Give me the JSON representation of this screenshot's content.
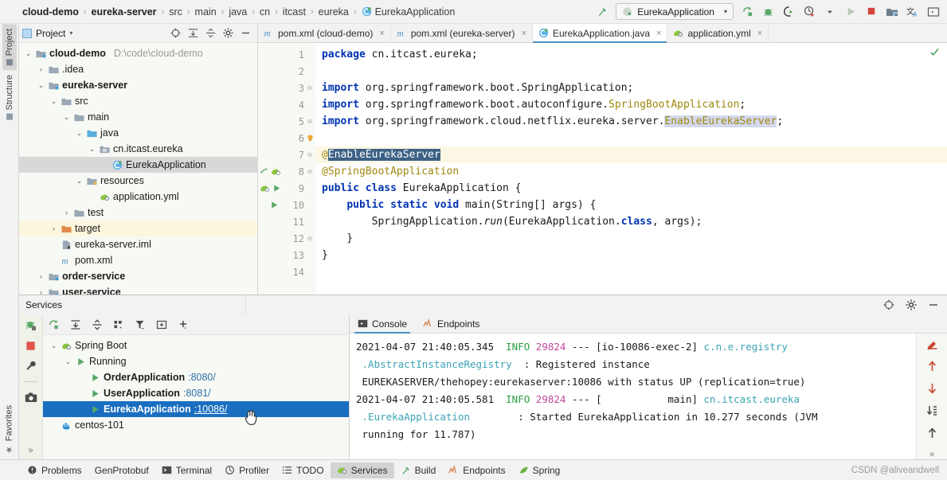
{
  "breadcrumb": {
    "items": [
      {
        "label": "cloud-demo",
        "bold": true
      },
      {
        "label": "eureka-server",
        "bold": true
      },
      {
        "label": "src",
        "bold": false
      },
      {
        "label": "main",
        "bold": false
      },
      {
        "label": "java",
        "bold": false
      },
      {
        "label": "cn",
        "bold": false
      },
      {
        "label": "itcast",
        "bold": false
      },
      {
        "label": "eureka",
        "bold": false
      },
      {
        "label": "EurekaApplication",
        "bold": false,
        "icon": "java-class-icon"
      }
    ],
    "separator": "›"
  },
  "toolbar": {
    "hammer_icon": "build-hammer-icon",
    "run_config_name": "EurekaApplication",
    "run_config_icon": "spring-boot-icon",
    "caret": "▾",
    "icons": [
      "rerun-icon",
      "debug-icon",
      "run-with-coverage-icon",
      "profiler-icon",
      "run-icon",
      "stop-icon",
      "project-structure-icon",
      "translate-icon",
      "terminal-icon"
    ]
  },
  "left_strip": {
    "tabs": [
      {
        "label": "Project",
        "active": true,
        "icon": "project-icon"
      },
      {
        "label": "Structure",
        "active": false,
        "icon": "structure-icon"
      }
    ],
    "bottom_tabs": [
      {
        "label": "Favorites",
        "active": false,
        "icon": "star-icon"
      }
    ]
  },
  "project_panel": {
    "title": "Project",
    "title_caret": "▾",
    "header_icons": [
      "locate-icon",
      "expand-all-icon",
      "collapse-all-icon",
      "settings-gear-icon",
      "hide-icon"
    ],
    "tree": [
      {
        "depth": 0,
        "arrow": "⌄",
        "icon": "module-folder-icon",
        "label": "cloud-demo",
        "bold": true,
        "path": "D:\\code\\cloud-demo",
        "state": "normal"
      },
      {
        "depth": 1,
        "arrow": "›",
        "icon": "folder-icon",
        "label": ".idea",
        "bold": false,
        "path": "",
        "state": "normal"
      },
      {
        "depth": 1,
        "arrow": "⌄",
        "icon": "module-folder-icon",
        "label": "eureka-server",
        "bold": true,
        "path": "",
        "state": "normal"
      },
      {
        "depth": 2,
        "arrow": "⌄",
        "icon": "folder-icon",
        "label": "src",
        "bold": false,
        "path": "",
        "state": "normal"
      },
      {
        "depth": 3,
        "arrow": "⌄",
        "icon": "folder-icon",
        "label": "main",
        "bold": false,
        "path": "",
        "state": "normal"
      },
      {
        "depth": 4,
        "arrow": "⌄",
        "icon": "source-folder-icon",
        "label": "java",
        "bold": false,
        "path": "",
        "state": "normal"
      },
      {
        "depth": 5,
        "arrow": "⌄",
        "icon": "package-icon",
        "label": "cn.itcast.eureka",
        "bold": false,
        "path": "",
        "state": "normal"
      },
      {
        "depth": 6,
        "arrow": "",
        "icon": "java-class-icon",
        "label": "EurekaApplication",
        "bold": false,
        "path": "",
        "state": "sel-grey"
      },
      {
        "depth": 4,
        "arrow": "⌄",
        "icon": "resource-folder-icon",
        "label": "resources",
        "bold": false,
        "path": "",
        "state": "normal"
      },
      {
        "depth": 5,
        "arrow": "",
        "icon": "yaml-icon",
        "label": "application.yml",
        "bold": false,
        "path": "",
        "state": "normal"
      },
      {
        "depth": 3,
        "arrow": "›",
        "icon": "folder-icon",
        "label": "test",
        "bold": false,
        "path": "",
        "state": "normal"
      },
      {
        "depth": 2,
        "arrow": "›",
        "icon": "target-folder-icon",
        "label": "target",
        "bold": false,
        "path": "",
        "state": "sel-yellow"
      },
      {
        "depth": 2,
        "arrow": "",
        "icon": "iml-icon",
        "label": "eureka-server.iml",
        "bold": false,
        "path": "",
        "state": "normal"
      },
      {
        "depth": 2,
        "arrow": "",
        "icon": "maven-icon",
        "label": "pom.xml",
        "bold": false,
        "path": "",
        "state": "normal"
      },
      {
        "depth": 1,
        "arrow": "›",
        "icon": "module-folder-icon",
        "label": "order-service",
        "bold": true,
        "path": "",
        "state": "normal"
      },
      {
        "depth": 1,
        "arrow": "›",
        "icon": "module-folder-icon",
        "label": "user-service",
        "bold": true,
        "path": "",
        "state": "normal"
      }
    ]
  },
  "editor": {
    "tabs": [
      {
        "label": "pom.xml (cloud-demo)",
        "icon": "maven-icon",
        "active": false,
        "close": "×"
      },
      {
        "label": "pom.xml (eureka-server)",
        "icon": "maven-icon",
        "active": false,
        "close": "×"
      },
      {
        "label": "EurekaApplication.java",
        "icon": "java-class-icon",
        "active": true,
        "close": "×"
      },
      {
        "label": "application.yml",
        "icon": "yaml-icon",
        "active": false,
        "close": "×"
      }
    ],
    "line_numbers": [
      "1",
      "2",
      "3",
      "4",
      "5",
      "6",
      "7",
      "8",
      "9",
      "10",
      "11",
      "12",
      "13",
      "14"
    ],
    "code_lines": [
      "package cn.itcast.eureka;",
      "",
      "import org.springframework.boot.SpringApplication;",
      "import org.springframework.boot.autoconfigure.SpringBootApplication;",
      "import org.springframework.cloud.netflix.eureka.server.EnableEurekaServer;",
      "",
      "@EnableEurekaServer",
      "@SpringBootApplication",
      "public class EurekaApplication {",
      "    public static void main(String[] args) {",
      "        SpringApplication.run(EurekaApplication.class, args);",
      "    }",
      "}",
      ""
    ],
    "inspection_status_icon": "inspections-ok-check-icon",
    "bulb_icon": "intention-bulb-icon"
  },
  "services": {
    "title": "Services",
    "header_icons": [
      "locate-icon",
      "settings-gear-icon",
      "hide-icon"
    ],
    "toolbar_icons": [
      "rerun-icon",
      "expand-all-icon",
      "collapse-all-icon",
      "group-icon",
      "filter-icon",
      "add-tab-icon",
      "add-service-icon"
    ],
    "side_icons": [
      "debug-icon",
      "stop-icon",
      "settings-wrench-icon",
      "camera-icon"
    ],
    "side_more": "»",
    "tree": [
      {
        "depth": 0,
        "arrow": "⌄",
        "icon": "spring-boot-icon",
        "label": "Spring Boot",
        "port": "",
        "bold": false,
        "selected": false
      },
      {
        "depth": 1,
        "arrow": "⌄",
        "icon": "run-triangle-icon",
        "label": "Running",
        "port": "",
        "bold": false,
        "selected": false
      },
      {
        "depth": 2,
        "arrow": "",
        "icon": "run-triangle-icon",
        "label": "OrderApplication",
        "port": ":8080/",
        "bold": true,
        "selected": false
      },
      {
        "depth": 2,
        "arrow": "",
        "icon": "run-triangle-icon",
        "label": "UserApplication",
        "port": ":8081/",
        "bold": true,
        "selected": false
      },
      {
        "depth": 2,
        "arrow": "",
        "icon": "run-triangle-icon",
        "label": "EurekaApplication",
        "port": ":10086/",
        "bold": true,
        "selected": true
      },
      {
        "depth": 0,
        "arrow": "",
        "icon": "docker-icon",
        "label": "centos-101",
        "port": "",
        "bold": false,
        "selected": false
      }
    ],
    "console_tabs": [
      {
        "label": "Console",
        "icon": "console-icon",
        "active": true
      },
      {
        "label": "Endpoints",
        "icon": "endpoints-icon",
        "active": false
      }
    ],
    "console_lines": [
      [
        {
          "t": "2021-04-07 21:40:05.345 ",
          "c": "plain"
        },
        {
          "t": " INFO",
          "c": "info"
        },
        {
          "t": " ",
          "c": "plain"
        },
        {
          "t": "29824",
          "c": "pid"
        },
        {
          "t": " --- [io-10086-exec-2] ",
          "c": "plain"
        },
        {
          "t": "c.n.e.registry",
          "c": "logger"
        }
      ],
      [
        {
          "t": " ",
          "c": "plain"
        },
        {
          "t": ".AbstractInstanceRegistry",
          "c": "logger"
        },
        {
          "t": "  : Registered instance",
          "c": "plain"
        }
      ],
      [
        {
          "t": " EUREKASERVER/thehopey:eurekaserver:10086 with status UP (replication=true)",
          "c": "plain"
        }
      ],
      [
        {
          "t": "2021-04-07 21:40:05.581 ",
          "c": "plain"
        },
        {
          "t": " INFO",
          "c": "info"
        },
        {
          "t": " ",
          "c": "plain"
        },
        {
          "t": "29824",
          "c": "pid"
        },
        {
          "t": " --- [           main] ",
          "c": "plain"
        },
        {
          "t": "cn.itcast.eureka",
          "c": "logger"
        }
      ],
      [
        {
          "t": " ",
          "c": "plain"
        },
        {
          "t": ".EurekaApplication",
          "c": "logger"
        },
        {
          "t": "        : Started EurekaApplication in 10.277 seconds (JVM",
          "c": "plain"
        }
      ],
      [
        {
          "t": " running for 11.787)",
          "c": "plain"
        }
      ]
    ],
    "console_gutter_icons": [
      "soft-wrap-icon",
      "up-arrow-icon",
      "down-arrow-icon",
      "scroll-to-end-icon",
      "up-arrow-dark-icon"
    ],
    "console_gutter_more": "»"
  },
  "statusbar": {
    "items": [
      {
        "label": "Problems",
        "icon": "problems-icon",
        "active": false
      },
      {
        "label": "GenProtobuf",
        "icon": "",
        "active": false
      },
      {
        "label": "Terminal",
        "icon": "terminal-icon",
        "active": false
      },
      {
        "label": "Profiler",
        "icon": "profiler-icon",
        "active": false
      },
      {
        "label": "TODO",
        "icon": "todo-icon",
        "active": false
      },
      {
        "label": "Services",
        "icon": "services-icon",
        "active": true
      },
      {
        "label": "Build",
        "icon": "build-hammer-icon",
        "active": false
      },
      {
        "label": "Endpoints",
        "icon": "endpoints-icon",
        "active": false
      },
      {
        "label": "Spring",
        "icon": "spring-leaf-icon",
        "active": false
      }
    ],
    "watermark": "CSDN @aliveandwell"
  },
  "colors": {
    "accent_blue": "#1a6ec0",
    "tab_underline": "#4a90c4",
    "keyword": "#0033b3",
    "annotation": "#9e880d",
    "selection": "#3d6185",
    "info_green": "#2a9d3f",
    "pid_magenta": "#c0499c",
    "logger_cyan": "#3aa3b5",
    "highlight_yellow": "#fbf7e4"
  }
}
